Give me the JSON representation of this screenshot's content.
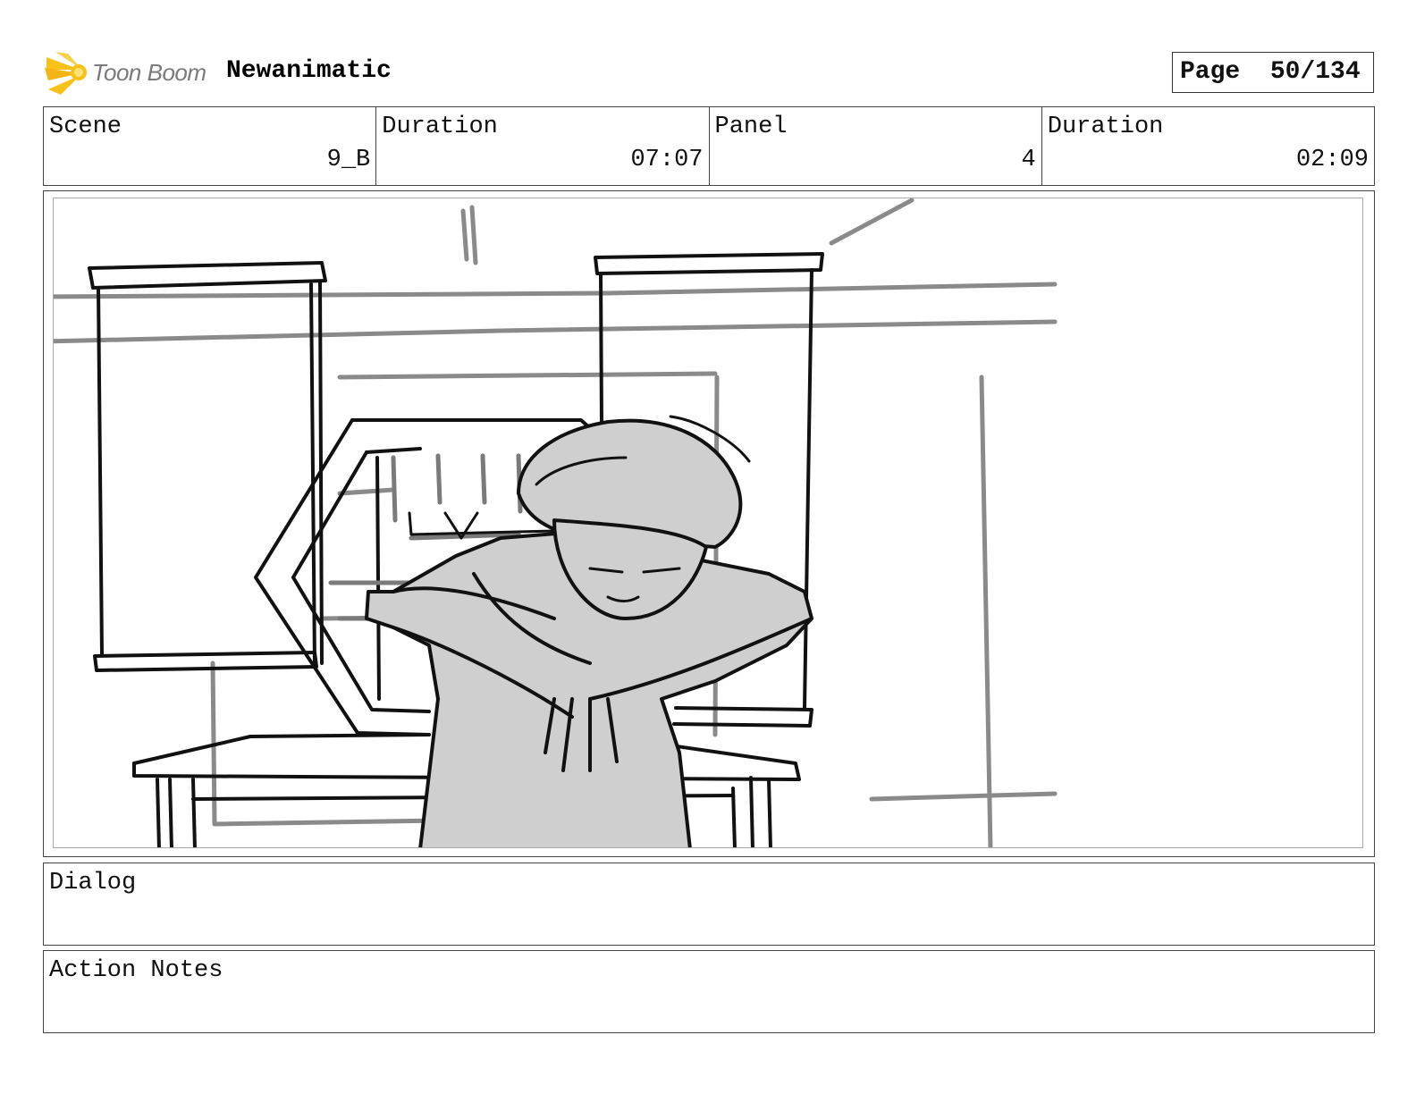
{
  "header": {
    "brand": "Toon Boom",
    "project_title": "Newanimatic",
    "page_label": "Page",
    "page_value": "50/134",
    "logo_icon": "toon-boom-logo-icon",
    "logo_color": "#f6c21a"
  },
  "info": {
    "scene_label": "Scene",
    "scene_value": "9_B",
    "scene_duration_label": "Duration",
    "scene_duration_value": "07:07",
    "panel_label": "Panel",
    "panel_value": "4",
    "panel_duration_label": "Duration",
    "panel_duration_value": "02:09"
  },
  "panel": {
    "description": "storyboard-sketch",
    "fill_color": "#cfcfcf"
  },
  "dialog": {
    "label": "Dialog",
    "text": ""
  },
  "action_notes": {
    "label": "Action Notes",
    "text": ""
  }
}
